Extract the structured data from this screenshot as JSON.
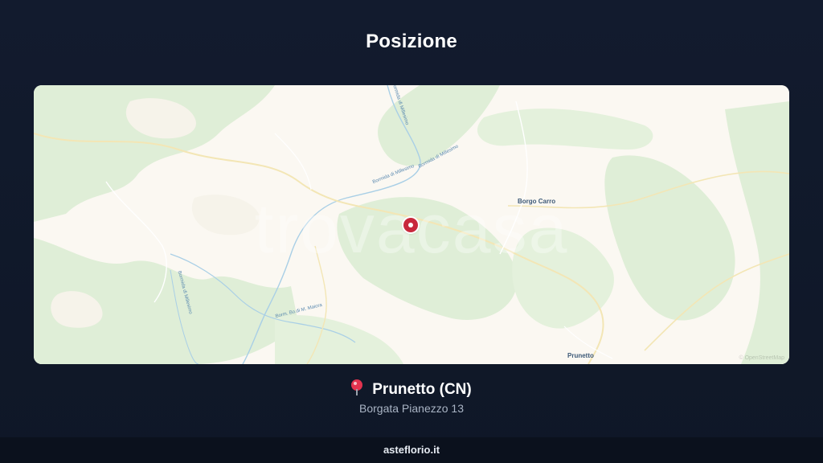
{
  "header": {
    "title": "Posizione"
  },
  "map": {
    "watermark": "trovacasa",
    "attribution": "© OpenStreetMap",
    "labels": {
      "borgo_carro": "Borgo Carro",
      "prunetto": "Prunetto"
    },
    "river_labels": {
      "bormida_1": "Bormida di Millesimo",
      "bormida_2": "Bormida di Millesimo",
      "bormida_3": "Bormida di Millesimo",
      "bormida_4": "Bormida di Millesimo",
      "bormida_5": "Borm. Bo.di M. Maiora"
    },
    "marker_icon": "location-marker-icon"
  },
  "location": {
    "icon": "pin-icon",
    "name": "Prunetto (CN)",
    "address": "Borgata Pianezzo 13"
  },
  "footer": {
    "site": "asteflorio.it"
  },
  "colors": {
    "background": "#111a2b",
    "footer": "#0b111d",
    "marker": "#c8283c",
    "pin": "#e2334f",
    "map_forest": "#dfeed7",
    "map_land": "#fbf8f2"
  }
}
